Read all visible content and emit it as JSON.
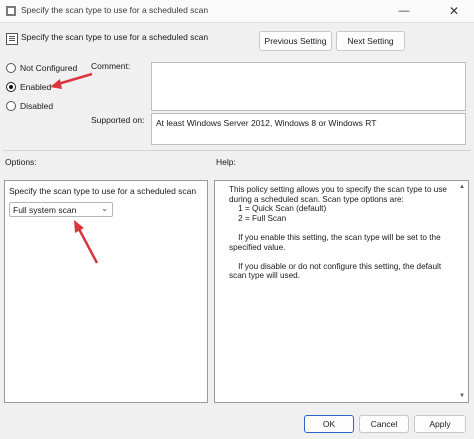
{
  "window": {
    "title": "Specify the scan type to use for a scheduled scan",
    "minimize_glyph": "—",
    "close_glyph": "✕"
  },
  "header": {
    "policy_name": "Specify the scan type to use for a scheduled scan",
    "previous_label": "Previous Setting",
    "next_label": "Next Setting"
  },
  "state": {
    "options": [
      {
        "label": "Not Configured",
        "selected": false
      },
      {
        "label": "Enabled",
        "selected": true
      },
      {
        "label": "Disabled",
        "selected": false
      }
    ]
  },
  "comment": {
    "label": "Comment:",
    "value": ""
  },
  "supported": {
    "label": "Supported on:",
    "value": "At least Windows Server 2012, Windows 8 or Windows RT"
  },
  "options_pane": {
    "header": "Options:",
    "field_label": "Specify the scan type to use for a scheduled scan",
    "selected_value": "Full system scan"
  },
  "help_pane": {
    "header": "Help:",
    "text": "This policy setting allows you to specify the scan type to use during a scheduled scan. Scan type options are:\n    1 = Quick Scan (default)\n    2 = Full Scan\n\n    If you enable this setting, the scan type will be set to the specified value.\n\n    If you disable or do not configure this setting, the default scan type will used."
  },
  "footer": {
    "ok_label": "OK",
    "cancel_label": "Cancel",
    "apply_label": "Apply"
  },
  "colors": {
    "annotation_arrow": "#d9363e",
    "ok_border": "#2566c8"
  }
}
